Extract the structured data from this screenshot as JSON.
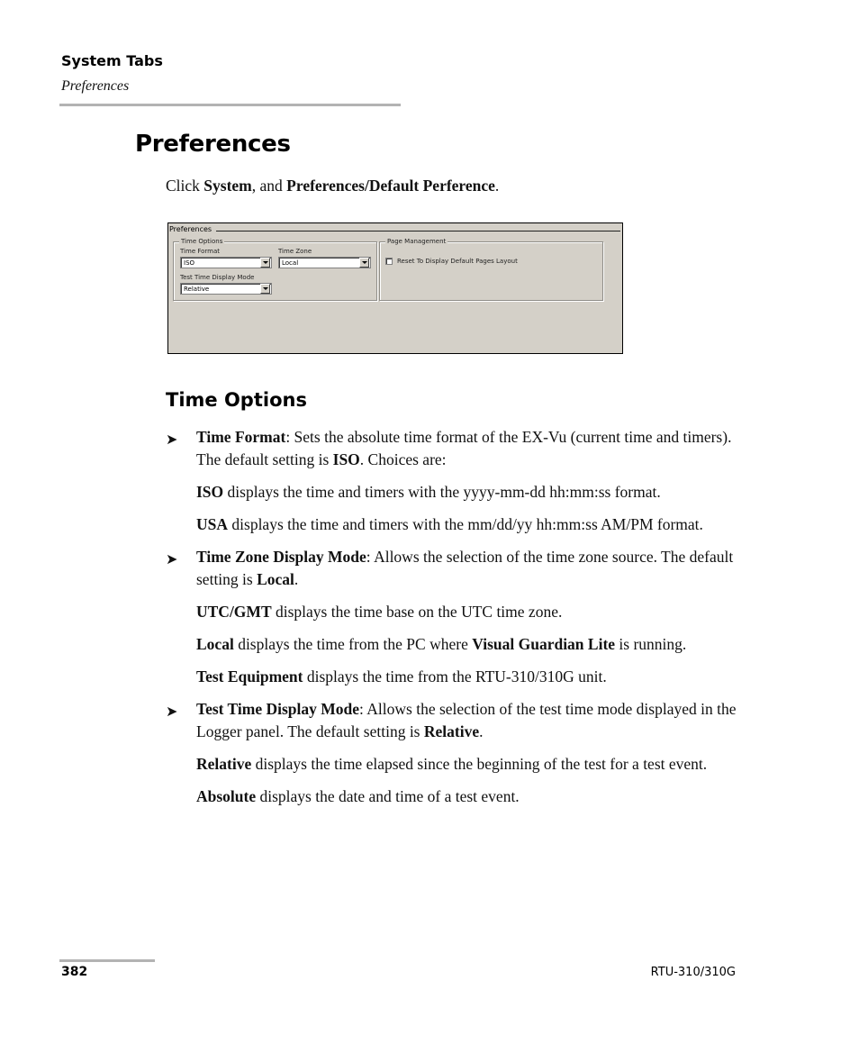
{
  "running_head": {
    "section": "System Tabs",
    "subsection": "Preferences"
  },
  "page_title": "Preferences",
  "intro": {
    "prefix": "Click ",
    "bold1": "System",
    "middle": ", and ",
    "bold2": "Preferences/Default Perference",
    "suffix": "."
  },
  "screenshot": {
    "window_title": "Preferences",
    "time_options": {
      "legend": "Time Options",
      "time_format_label": "Time Format",
      "time_format_value": "ISO",
      "time_zone_label": "Time Zone",
      "time_zone_value": "Local",
      "test_time_label": "Test Time Display Mode",
      "test_time_value": "Relative"
    },
    "page_management": {
      "legend": "Page Management",
      "reset_checkbox_label": "Reset To Display Default Pages Layout",
      "reset_checked": false
    }
  },
  "section_heading": "Time Options",
  "bullets": [
    {
      "term": "Time Format",
      "text": ": Sets the absolute time format of the EX-Vu (current time and timers). The default setting is ",
      "default": "ISO",
      "tail": ". Choices are:",
      "choices": [
        {
          "term": "ISO",
          "text": " displays the time and timers with the yyyy-mm-dd hh:mm:ss format."
        },
        {
          "term": "USA",
          "text": " displays the time and timers with the mm/dd/yy hh:mm:ss AM/PM format."
        }
      ]
    },
    {
      "term": "Time Zone Display Mode",
      "text": ": Allows the selection of the time zone source. The default setting is ",
      "default": "Local",
      "tail": ".",
      "choices": [
        {
          "term": "UTC/GMT",
          "text": " displays the time base on the UTC time zone."
        },
        {
          "term": "Local",
          "text": " displays the time from the PC where ",
          "term2": "Visual Guardian Lite",
          "text2": " is running."
        },
        {
          "term": "Test Equipment",
          "text": " displays the time from the RTU-310/310G unit."
        }
      ]
    },
    {
      "term": "Test Time Display Mode",
      "text": ": Allows the selection of the test time mode displayed in the Logger panel. The default setting is ",
      "default": "Relative",
      "tail": ".",
      "choices": [
        {
          "term": "Relative",
          "text": " displays the time elapsed since the beginning of the test for a test event."
        },
        {
          "term": "Absolute",
          "text": " displays the date and time of a test event."
        }
      ]
    }
  ],
  "bullet_icon": "arrowhead-right-icon",
  "footer": {
    "page_number": "382",
    "document_id": "RTU-310/310G"
  }
}
